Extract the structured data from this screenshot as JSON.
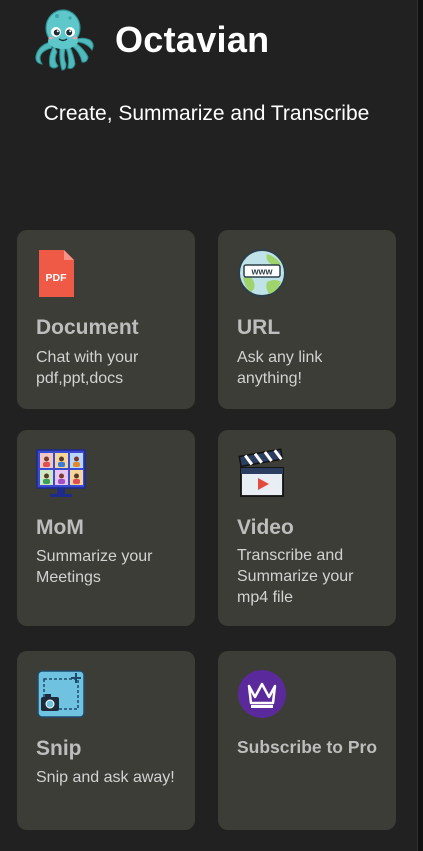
{
  "app": {
    "title": "Octavian",
    "tagline": "Create, Summarize and Transcribe",
    "logo_icon": "octopus-icon"
  },
  "colors": {
    "background": "#212121",
    "card": "#3d3d37",
    "title_text": "#bdbdbd",
    "desc_text": "#d2d2d2",
    "octopus_teal": "#5ec7c9",
    "pro_purple": "#5a2a9c"
  },
  "cards": [
    {
      "id": "document",
      "icon": "pdf-file-icon",
      "title": "Document",
      "description": "Chat with your pdf,ppt,docs",
      "icon_text": "PDF"
    },
    {
      "id": "url",
      "icon": "globe-www-icon",
      "title": "URL",
      "description": "Ask any link anything!",
      "icon_text": "www"
    },
    {
      "id": "mom",
      "icon": "video-meeting-icon",
      "title": "MoM",
      "description": "Summarize your Meetings"
    },
    {
      "id": "video",
      "icon": "clapperboard-icon",
      "title": "Video",
      "description": "Transcribe and Summarize your mp4 file"
    },
    {
      "id": "snip",
      "icon": "screenshot-snip-icon",
      "title": "Snip",
      "description": "Snip and ask away!"
    },
    {
      "id": "pro",
      "icon": "crown-icon",
      "title": "Subscribe to Pro",
      "description": ""
    }
  ]
}
